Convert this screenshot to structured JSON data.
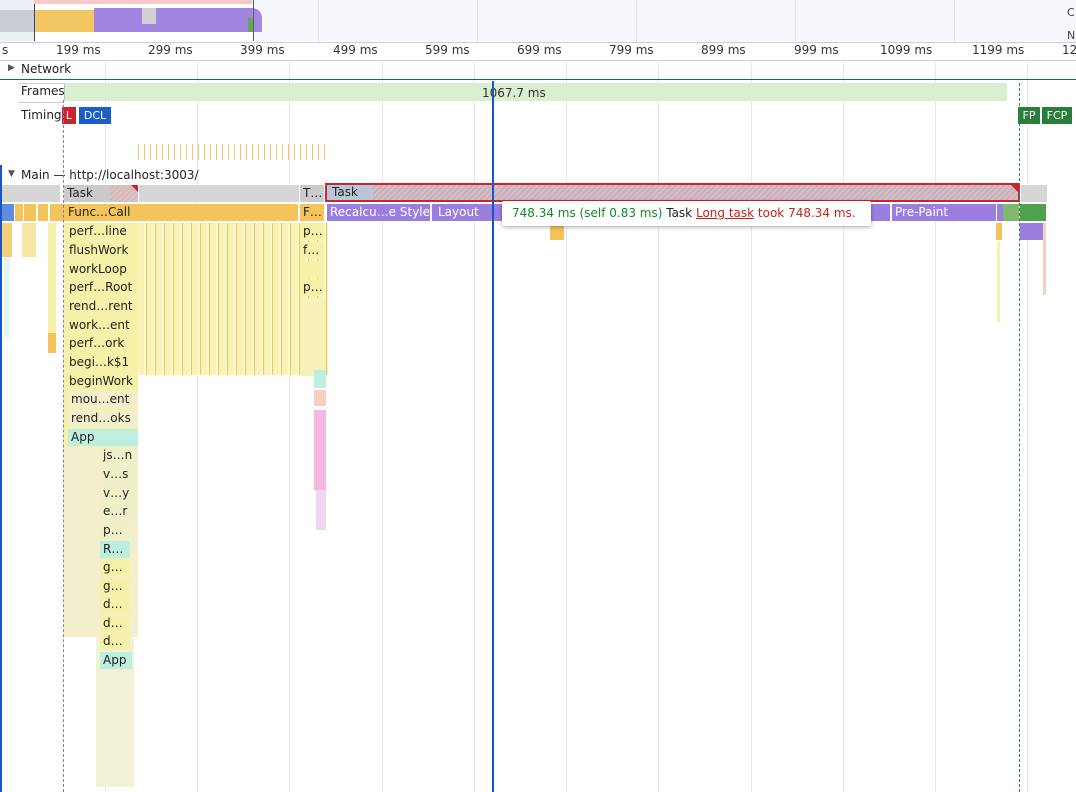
{
  "overview": {
    "right_labels": [
      "C",
      "N"
    ]
  },
  "ruler": {
    "ticks": [
      "s",
      "199 ms",
      "299 ms",
      "399 ms",
      "499 ms",
      "599 ms",
      "699 ms",
      "799 ms",
      "899 ms",
      "999 ms",
      "1099 ms",
      "1199 ms",
      "12"
    ]
  },
  "tracks": {
    "network_label": "Network",
    "frames_label": "Frames",
    "frames_duration": "1067.7 ms",
    "timings_label": "Timings",
    "timings_markers": {
      "l": "L",
      "dcl": "DCL",
      "fp": "FP",
      "fcp": "FCP"
    },
    "main_label": "Main — http://localhost:3003/"
  },
  "flame": {
    "task_left": "Task",
    "task_mid": "T…",
    "task_long": "Task",
    "func_call": "Func…Call",
    "f_mid": "F…",
    "recalc": "Recalcu…e Style",
    "layout": "Layout",
    "pre_paint": "Pre-Paint",
    "stack": [
      "perf…line",
      "flushWork",
      "workLoop",
      "perf…Root",
      "rend…rent",
      "work…ent",
      "perf…ork",
      "begi…k$1",
      "beginWork",
      "mou…ent",
      "rend…oks",
      "App"
    ],
    "mid_stack": [
      "p…",
      "f…",
      "",
      "p…"
    ],
    "deep_stack": [
      "js…n",
      "v…s",
      "v…y",
      "e…r",
      "p…",
      "R…",
      "g…",
      "g…",
      "d…",
      "d…",
      "d…",
      "App"
    ]
  },
  "tooltip": {
    "duration": "748.34 ms (self 0.83 ms)",
    "name": "Task",
    "link": "Long task",
    "suffix": "took 748.34 ms."
  },
  "colors": {
    "scripting": "#f2c45a",
    "rendering": "#9b7fe0",
    "task": "#cbcbcb",
    "long_task_border": "#d3222f",
    "dcl": "#1a5fc6",
    "fp": "#2b7d3b",
    "frames": "#d9efcf",
    "cursor": "#1a56c2",
    "tooltip_green": "#118a26",
    "tooltip_red": "#c5221f"
  }
}
